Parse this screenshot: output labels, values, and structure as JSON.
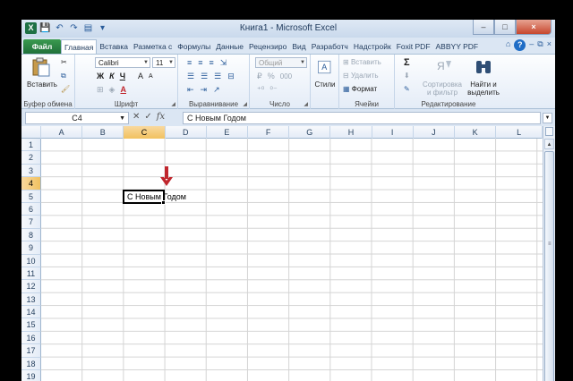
{
  "window": {
    "title": "Книга1  -  Microsoft Excel",
    "controls": [
      "–",
      "□",
      "×"
    ]
  },
  "qat": {
    "items": [
      "X",
      "💾",
      "↶",
      "↷",
      "▤",
      "▾"
    ]
  },
  "tabs": [
    {
      "label": "Файл",
      "kind": "file"
    },
    {
      "label": "Главная",
      "kind": "active"
    },
    {
      "label": "Вставка"
    },
    {
      "label": "Разметка с"
    },
    {
      "label": "Формулы"
    },
    {
      "label": "Данные"
    },
    {
      "label": "Рецензиро"
    },
    {
      "label": "Вид"
    },
    {
      "label": "Разработч"
    },
    {
      "label": "Надстройк"
    },
    {
      "label": "Foxit PDF"
    },
    {
      "label": "ABBYY PDF"
    }
  ],
  "tabs_right": {
    "help": "?",
    "icons": [
      "⌂",
      "–",
      "⧉",
      "×"
    ]
  },
  "ribbon": {
    "clipboard": {
      "label": "Буфер обмена",
      "paste": "Вставить"
    },
    "font": {
      "label": "Шрифт",
      "font_name": "Calibri",
      "font_size": "11",
      "bold": "Ж",
      "italic": "К",
      "underline": "Ч",
      "grow": "A",
      "shrink": "A",
      "font_color_letter": "A"
    },
    "alignment": {
      "label": "Выравнивание"
    },
    "number": {
      "label": "Число",
      "format": "Общий",
      "percent": "%",
      "thousands": "000"
    },
    "styles": {
      "label": "",
      "button": "Стили"
    },
    "cells": {
      "label": "Ячейки",
      "insert": "Вставить",
      "delete": "Удалить",
      "format": "Формат"
    },
    "editing": {
      "label": "Редактирование",
      "sigma": "Σ",
      "sort_line1": "Сортировка",
      "sort_line2": "и фильтр",
      "find_line1": "Найти и",
      "find_line2": "выделить"
    }
  },
  "formula_bar": {
    "name_box": "C4",
    "cancel": "✕",
    "enter": "✓",
    "fx": "fx",
    "value": "С Новым Годом"
  },
  "grid": {
    "columns": [
      "A",
      "B",
      "C",
      "D",
      "E",
      "F",
      "G",
      "H",
      "I",
      "J",
      "K",
      "L"
    ],
    "selected_column": "C",
    "rows": [
      "1",
      "2",
      "3",
      "4",
      "5",
      "6",
      "7",
      "8",
      "9",
      "10",
      "11",
      "12",
      "13",
      "14",
      "15",
      "16",
      "17",
      "18",
      "19"
    ],
    "selected_row": "4",
    "cell_C4": "С Новым Годом"
  },
  "colors": {
    "file_tab": "#20703a",
    "selected_header": "#f1c15f",
    "arrow": "#c0262d"
  }
}
